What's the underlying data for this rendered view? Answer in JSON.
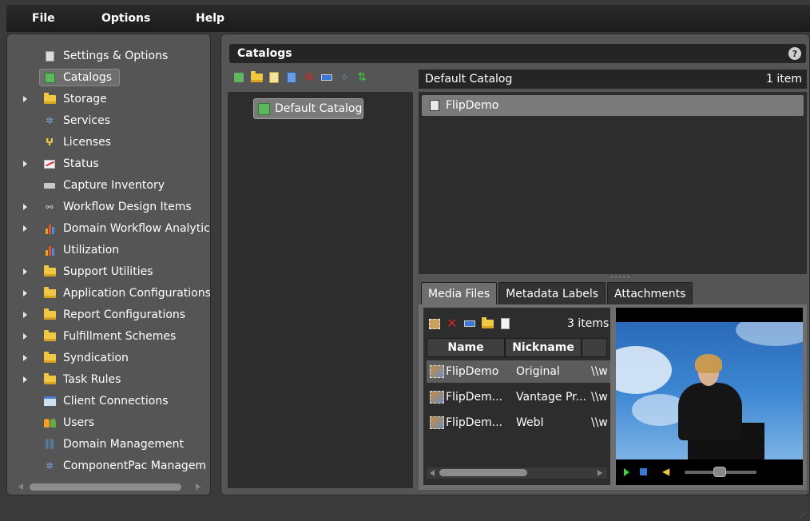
{
  "menubar": {
    "file": "File",
    "options": "Options",
    "help": "Help"
  },
  "sidebar": {
    "items": [
      {
        "label": "Settings & Options",
        "icon": "settings-icon",
        "expandable": false
      },
      {
        "label": "Catalogs",
        "icon": "catalog-icon",
        "expandable": false,
        "selected": true
      },
      {
        "label": "Storage",
        "icon": "folder-icon",
        "expandable": true
      },
      {
        "label": "Services",
        "icon": "services-icon",
        "expandable": false
      },
      {
        "label": "Licenses",
        "icon": "key-icon",
        "expandable": false
      },
      {
        "label": "Status",
        "icon": "status-chart-icon",
        "expandable": true
      },
      {
        "label": "Capture Inventory",
        "icon": "capture-icon",
        "expandable": false
      },
      {
        "label": "Workflow Design Items",
        "icon": "workflow-icon",
        "expandable": true
      },
      {
        "label": "Domain Workflow Analytic",
        "icon": "analytics-icon",
        "expandable": true
      },
      {
        "label": "Utilization",
        "icon": "utilization-icon",
        "expandable": false
      },
      {
        "label": "Support Utilities",
        "icon": "folder-icon",
        "expandable": true
      },
      {
        "label": "Application Configurations",
        "icon": "folder-icon",
        "expandable": true
      },
      {
        "label": "Report Configurations",
        "icon": "folder-icon",
        "expandable": true
      },
      {
        "label": "Fulfillment Schemes",
        "icon": "folder-icon",
        "expandable": true
      },
      {
        "label": "Syndication",
        "icon": "folder-icon",
        "expandable": true
      },
      {
        "label": "Task Rules",
        "icon": "folder-icon",
        "expandable": true
      },
      {
        "label": "Client Connections",
        "icon": "client-connections-icon",
        "expandable": false
      },
      {
        "label": "Users",
        "icon": "users-icon",
        "expandable": false
      },
      {
        "label": "Domain Management",
        "icon": "domain-icon",
        "expandable": false
      },
      {
        "label": "ComponentPac Managem",
        "icon": "componentpac-icon",
        "expandable": false
      }
    ]
  },
  "catalogs": {
    "title": "Catalogs",
    "help": "?",
    "list": [
      "Default Catalog"
    ],
    "selected_name": "Default Catalog",
    "item_count": "1 item",
    "items": [
      "FlipDemo"
    ]
  },
  "media_tabs": [
    "Media Files",
    "Metadata Labels",
    "Attachments"
  ],
  "media": {
    "count": "3 items",
    "columns": [
      "Name",
      "Nickname"
    ],
    "rows": [
      {
        "name": "FlipDemo",
        "nickname": "Original",
        "path": "\\\\w"
      },
      {
        "name": "FlipDem...",
        "nickname": "Vantage Pr...",
        "path": "\\\\w"
      },
      {
        "name": "FlipDem...",
        "nickname": "WebI",
        "path": "\\\\w"
      }
    ]
  },
  "colors": {
    "accent_green": "#3fcf3f",
    "delete_red": "#e02020",
    "folder_yellow": "#f2c744"
  }
}
